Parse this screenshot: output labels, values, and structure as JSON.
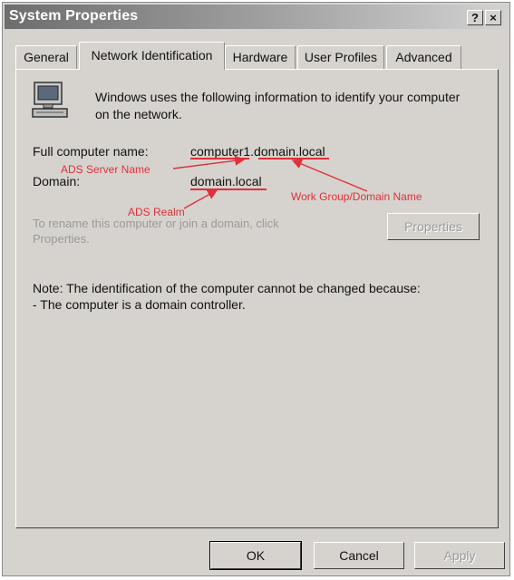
{
  "window": {
    "title": "System Properties",
    "help_button": "?",
    "close_button": "×"
  },
  "tabs": [
    {
      "label": "General"
    },
    {
      "label": "Network Identification"
    },
    {
      "label": "Hardware"
    },
    {
      "label": "User Profiles"
    },
    {
      "label": "Advanced"
    }
  ],
  "panel": {
    "intro_line1": "Windows uses the following information to identify your computer",
    "intro_line2": "on the network.",
    "full_name_label": "Full computer name:",
    "full_name_value_host": "computer1",
    "full_name_value_domain": ".domain.local",
    "domain_label": "Domain:",
    "domain_value": "domain.local",
    "rename_line1": "To rename this computer or join a domain, click",
    "rename_line2": "Properties.",
    "properties_button": "Properties",
    "note_line1": "Note: The identification of the computer cannot be changed because:",
    "note_line2": "- The computer is a domain controller."
  },
  "annotations": {
    "ads_server_name": "ADS Server Name",
    "ads_realm": "ADS Realm",
    "workgroup_domain_name": "Work Group/Domain Name",
    "color": "#e0303a"
  },
  "footer": {
    "ok": "OK",
    "cancel": "Cancel",
    "apply": "Apply"
  },
  "icon": {
    "panel_icon": "computer-icon"
  }
}
